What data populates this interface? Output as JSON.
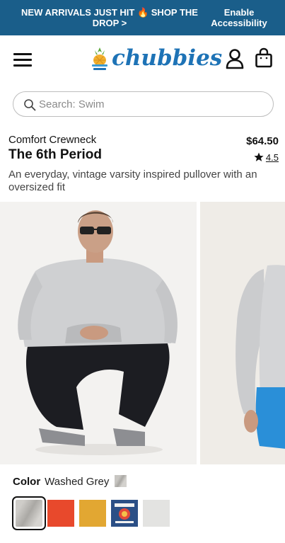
{
  "promo": {
    "text": "NEW ARRIVALS JUST HIT 🔥 SHOP THE DROP >",
    "accessibility_line1": "Enable",
    "accessibility_line2": "Accessibility"
  },
  "header": {
    "brand": "chubbies"
  },
  "search": {
    "placeholder": "Search: Swim"
  },
  "product": {
    "type": "Comfort Crewneck",
    "title": "The 6th Period",
    "price": "$64.50",
    "rating": "4.5",
    "description": "An everyday, vintage varsity inspired pullover with an oversized fit"
  },
  "color": {
    "label": "Color",
    "selected": "Washed Grey",
    "swatches": [
      {
        "name": "Washed Grey",
        "hex": "#bfbdb9"
      },
      {
        "name": "Red Orange",
        "hex": "#e8492c"
      },
      {
        "name": "Mustard",
        "hex": "#e2a732"
      },
      {
        "name": "Navy Graphic",
        "hex": "#284a7c"
      },
      {
        "name": "Light Grey",
        "hex": "#e3e3e1"
      }
    ]
  },
  "colors": {
    "promo_bg": "#1a5e8a",
    "brand_blue": "#1e73b6"
  },
  "icons": [
    "hamburger-menu-icon",
    "pineapple-logo-icon",
    "account-icon",
    "shopping-bag-icon",
    "search-icon",
    "star-icon"
  ]
}
